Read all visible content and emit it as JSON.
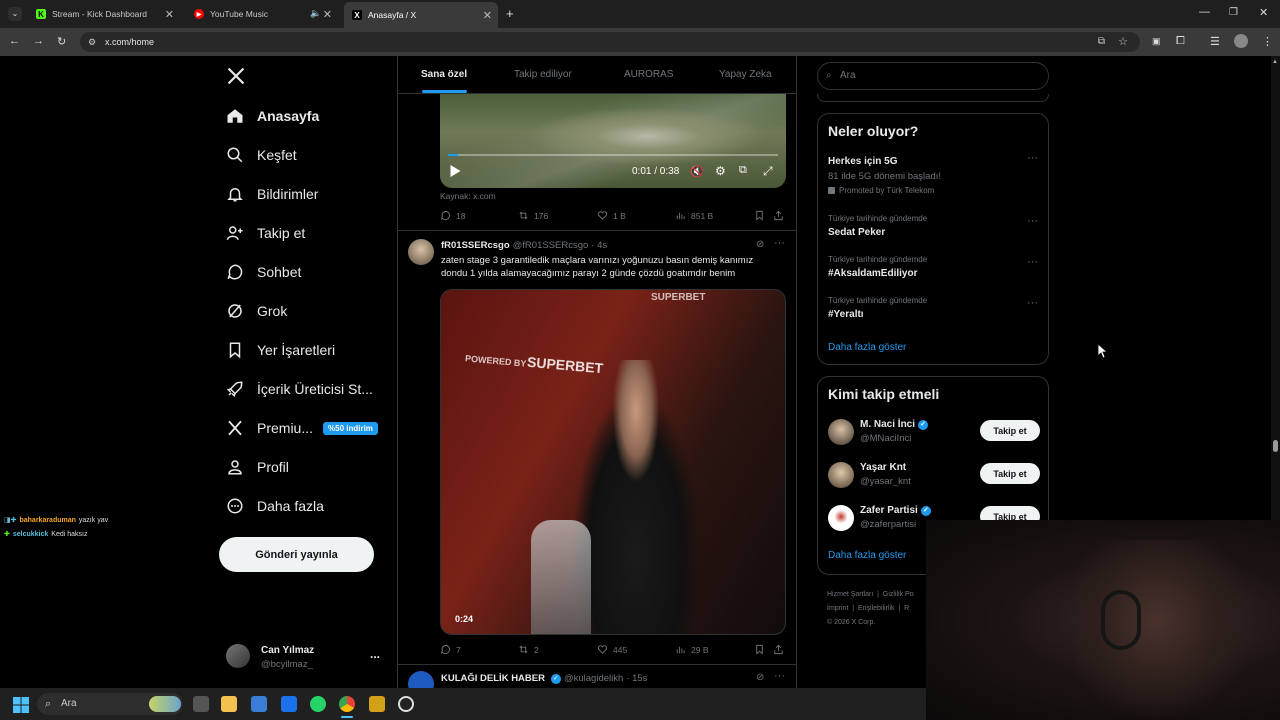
{
  "browser": {
    "tabs": [
      {
        "title": "Stream - Kick Dashboard",
        "favicon": "K",
        "color": "#53fc18"
      },
      {
        "title": "YouTube Music",
        "favicon": "▶",
        "color": "#ff0000"
      },
      {
        "title": "Anasayfa / X",
        "favicon": "X",
        "color": "#ffffff"
      }
    ],
    "url": "x.com/home"
  },
  "nav": {
    "home": "Anasayfa",
    "explore": "Keşfet",
    "notifications": "Bildirimler",
    "follow": "Takip et",
    "chat": "Sohbet",
    "grok": "Grok",
    "bookmarks": "Yer İşaretleri",
    "creator": "İçerik Üreticisi St...",
    "premium": "Premiu...",
    "premium_badge": "%50 indirim",
    "profile": "Profil",
    "more": "Daha fazla",
    "post_button": "Gönderi yayınla"
  },
  "account": {
    "name": "Can Yılmaz",
    "handle": "@bcyilmaz_",
    "menu": "..."
  },
  "feed_tabs": [
    "Sana özel",
    "Takip ediliyor",
    "AURORAS",
    "Yapay Zeka"
  ],
  "video1": {
    "time": "0:01 / 0:38",
    "source": "Kaynak: x.com",
    "progress": 0.03,
    "stats": {
      "replies": "18",
      "reposts": "176",
      "likes": "1 B",
      "views": "851 B"
    }
  },
  "post2": {
    "name": "fR01SSERcsgo",
    "handle": "@fR01SSERcsgo",
    "time": "· 4s",
    "text_line1": "zaten stage 3 garantiledik maçlara varınızı yoğunuzu basın demiş kanımız",
    "text_line2": "dondu 1 yılda alamayacağımız parayı 2 günde çözdü goatımdır benim",
    "video_duration": "0:24",
    "video_caption_brand": "SUPERBET",
    "video_caption_powered": "POWERED BY",
    "stats": {
      "replies": "7",
      "reposts": "2",
      "likes": "445",
      "views": "29 B"
    }
  },
  "post3": {
    "name": "KULAĞI DELİK HABER",
    "handle": "@kulagidelikh",
    "time": "· 15s"
  },
  "search_placeholder": "Ara",
  "trends": {
    "title": "Neler oluyor?",
    "items": [
      {
        "category": "",
        "name": "Herkes için 5G",
        "desc": "81 ilde 5G dönemi başladı!",
        "promoted": "Promoted by Türk Telekom"
      },
      {
        "category": "Türkiye tarihinde gündemde",
        "name": "Sedat Peker"
      },
      {
        "category": "Türkiye tarihinde gündemde",
        "name": "#AksaİdamEdiliyor"
      },
      {
        "category": "Türkiye tarihinde gündemde",
        "name": "#Yeraltı"
      }
    ],
    "show_more": "Daha fazla göster"
  },
  "who_to_follow": {
    "title": "Kimi takip etmeli",
    "users": [
      {
        "name": "M. Naci İnci",
        "handle": "@MNaciInci",
        "verified": true,
        "button": "Takip et"
      },
      {
        "name": "Yaşar Knt",
        "handle": "@yasar_knt",
        "verified": false,
        "button": "Takip et"
      },
      {
        "name": "Zafer Partisi",
        "handle": "@zaferpartisi",
        "verified": true,
        "button": "Takip et"
      }
    ],
    "show_more": "Daha fazla göster"
  },
  "footer_links": {
    "line1": "Hizmet Şartları  |  Gizlilik Po",
    "line2": "İmprint  |  Erişilebilirlik  |  R",
    "line3": "© 2026 X Corp."
  },
  "chat_overlay": [
    {
      "user": "baharkaraduman",
      "text": "yazık yav",
      "color": "#f5a623"
    },
    {
      "user": "selcukkick",
      "text": "Kedi haksız",
      "color": "#5bc0de"
    }
  ],
  "taskbar": {
    "search": "Ara"
  }
}
